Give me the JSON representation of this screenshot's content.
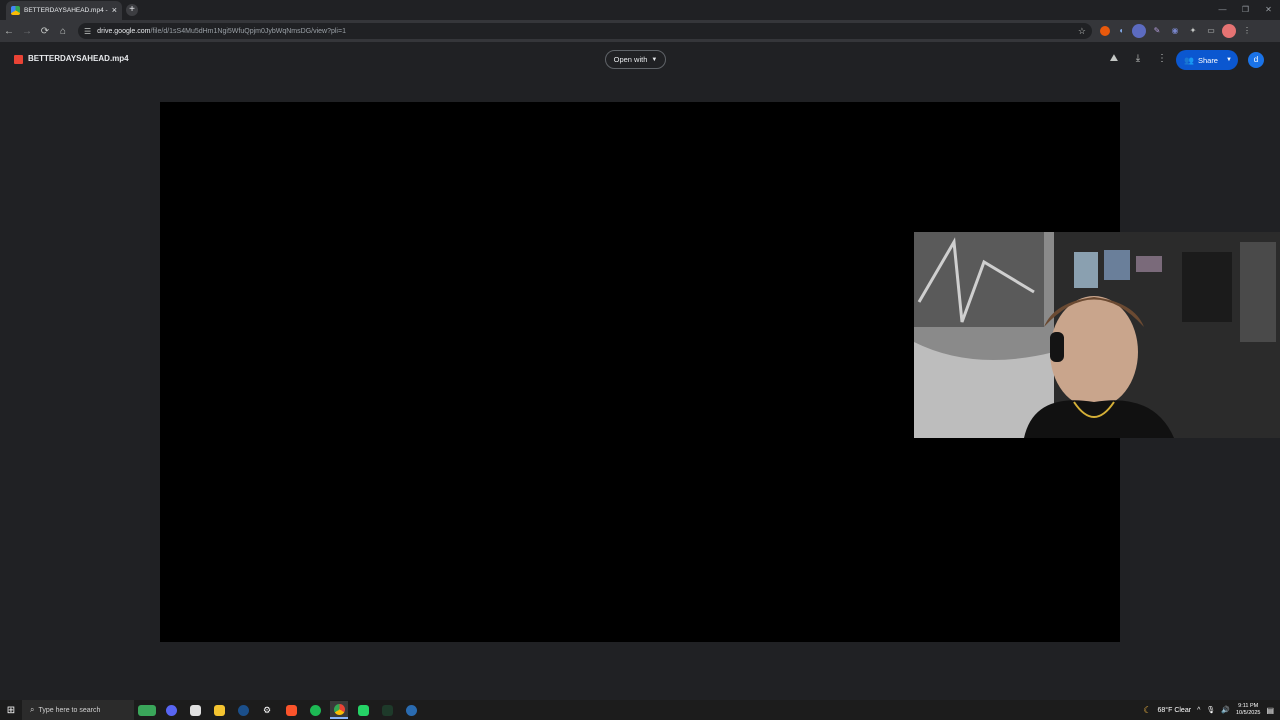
{
  "browser": {
    "tab_title": "BETTERDAYSAHEAD.mp4 - Goo",
    "url_host": "drive.google.com",
    "url_path": "/file/d/1sS4Mu5dHm1Ngi5WfuQpjm0JybWqNmsDG/view?pli=1",
    "controls": {
      "back": "←",
      "forward": "→",
      "reload": "⟳",
      "home": "⌂",
      "new_tab": "+",
      "close_tab": "×",
      "minimize": "—",
      "maximize": "❐",
      "close": "✕"
    }
  },
  "viewer": {
    "file_name": "BETTERDAYSAHEAD.mp4",
    "open_with_label": "Open with",
    "share_label": "Share",
    "account_initial": "d"
  },
  "taskbar": {
    "search_placeholder": "Type here to search",
    "weather": "68°F  Clear",
    "time": "9:11 PM",
    "date": "10/5/2025"
  },
  "colors": {
    "share_button": "#0b57d0",
    "account_avatar": "#1a73e8",
    "drive_file_icon": "#ea4335",
    "page_background": "#202124"
  }
}
